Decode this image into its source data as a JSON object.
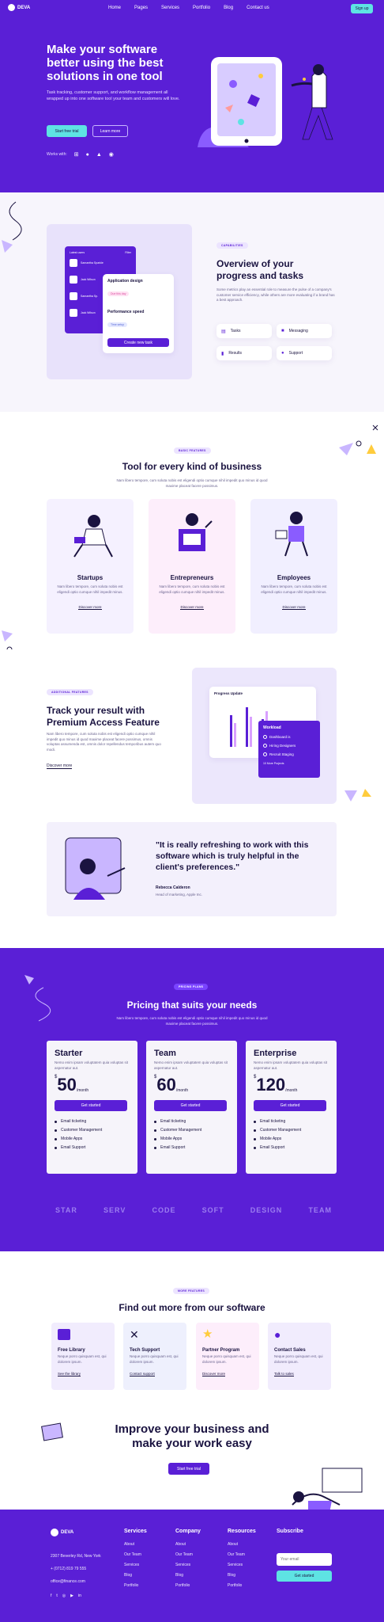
{
  "nav": {
    "brand": "DEVA",
    "links": [
      "Home",
      "Pages",
      "Services",
      "Portfolio",
      "Blog",
      "Contact us"
    ],
    "signup": "Sign up"
  },
  "hero": {
    "title": "Make your software better using the best solutions in one tool",
    "text": "Task tracking, customer support, and workflow management all wrapped up into one software tool your team and customers will love.",
    "btn_primary": "Start free trial",
    "btn_secondary": "Learn more",
    "works_with": "Works with:"
  },
  "overview": {
    "pill": "CAPABILITIES",
    "title": "Overview of your progress and tasks",
    "text": "Some metrics play an essential role to measure the pulse of a company's customer service efficiency, while others are more evaluating if a brand has a best approach.",
    "features": [
      "Tasks",
      "Messaging",
      "Results",
      "Support"
    ],
    "mock": {
      "header": "Latest users",
      "filter": "Filter",
      "users": [
        "Samantha Sparkle",
        "Jack Wilson",
        "Samantha Sp.",
        "Jack Wilson"
      ],
      "task1": "Application design",
      "task1_tag": "Due this day",
      "task2": "Performance speed",
      "task2_tag": "Time setup",
      "task_btn": "Create new task"
    }
  },
  "tools": {
    "pill": "BASIC FEATURES",
    "title": "Tool for every kind of business",
    "text": "Nam libero tempore, cum soluta nobis est eligendi optio cumque nihil impedit quo minus id quod maxime placeat facere possimus.",
    "cards": [
      {
        "title": "Startups",
        "text": "Nam libero tempore, cum soluta nobis est eligendi optio cumque nihil impedit minus.",
        "link": "Discover more"
      },
      {
        "title": "Entrepreneurs",
        "text": "Nam libero tempore, cum soluta nobis est eligendi optio cumque nihil impedit minus.",
        "link": "Discover more"
      },
      {
        "title": "Employees",
        "text": "Nam libero tempore, cum soluta nobis est eligendi optio cumque nihil impedit minus.",
        "link": "Discover more"
      }
    ]
  },
  "premium": {
    "pill": "ADDITIONAL FEATURES",
    "title": "Track your result with Premium Access Feature",
    "text": "Nam libero tempore, cum soluta nobis est eligendi optio cumque nihil impedit quo minus id quod maxime placeat facere possimus, omnis voluptas assumenda est, omnis dolor repellendus temporibus autem quo modi.",
    "link": "Discover more",
    "chart_title": "Progress Update",
    "workload_title": "Workload",
    "workload": [
      "Dashboard is",
      "Hiring Designers",
      "Recruit Staging"
    ],
    "workload_more": "10 More Projects"
  },
  "testimonial": {
    "quote": "\"It is really refreshing to work with this software which is truly helpful in the client's preferences.\"",
    "name": "Rebecca Calderon",
    "role": "Head of marketing, Apple Inc."
  },
  "pricing": {
    "pill": "PRICING PLANS",
    "title": "Pricing that suits your needs",
    "text": "Nam libero tempore, cum soluta nobis est eligendi optio cumque nihil impedit quo minus id quod maxime placeat facere possimus.",
    "plans": [
      {
        "name": "Starter",
        "desc": "Nemo enim ipsam voluptatem quia voluptas sit aspernatur aut.",
        "currency": "$",
        "price": "50",
        "period": "/month",
        "btn": "Get started",
        "features": [
          "Email ticketing",
          "Customer Management",
          "Mobile Apps",
          "Email Support"
        ]
      },
      {
        "name": "Team",
        "desc": "Nemo enim ipsam voluptatem quia voluptas sit aspernatur aut.",
        "currency": "$",
        "price": "60",
        "period": "/month",
        "btn": "Get started",
        "features": [
          "Email ticketing",
          "Customer Management",
          "Mobile Apps",
          "Email Support"
        ]
      },
      {
        "name": "Enterprise",
        "desc": "Nemo enim ipsam voluptatem quia voluptas sit aspernatur aut.",
        "currency": "$",
        "price": "120",
        "period": "/month",
        "btn": "Get started",
        "features": [
          "Email ticketing",
          "Customer Management",
          "Mobile Apps",
          "Email Support"
        ]
      }
    ],
    "logos": [
      "STAR",
      "SERV",
      "CODE",
      "SOFT",
      "DESIGN",
      "TEAM"
    ]
  },
  "more": {
    "pill": "MORE FEATURES",
    "title": "Find out more from our software",
    "cards": [
      {
        "title": "Free Library",
        "text": "Neque porro quisquam est, qui dolorem ipsum.",
        "link": "See the library"
      },
      {
        "title": "Tech Support",
        "text": "Neque porro quisquam est, qui dolorem ipsum.",
        "link": "Contact support"
      },
      {
        "title": "Partner Program",
        "text": "Neque porro quisquam est, qui dolorem ipsum.",
        "link": "Discover more"
      },
      {
        "title": "Contact Sales",
        "text": "Neque porro quisquam est, qui dolorem ipsum.",
        "link": "Talk to sales"
      }
    ]
  },
  "cta": {
    "title": "Improve your business and make your work easy",
    "btn": "Start free trial"
  },
  "footer": {
    "brand": "DEVA",
    "address": "2307 Beverley Rd, New York",
    "phone": "+ (0712) 819 79 555",
    "email": "office@finance.com",
    "cols": [
      {
        "title": "Services",
        "links": [
          "About",
          "Our Team",
          "Services",
          "Blog",
          "Portfolio"
        ]
      },
      {
        "title": "Company",
        "links": [
          "About",
          "Our Team",
          "Services",
          "Blog",
          "Portfolio"
        ]
      },
      {
        "title": "Resources",
        "links": [
          "About",
          "Our Team",
          "Services",
          "Blog",
          "Portfolio"
        ]
      }
    ],
    "subscribe_title": "Subscribe",
    "email_placeholder": "Your email",
    "subscribe_btn": "Get started"
  },
  "colors": {
    "brand": "#5a1fd6",
    "accent": "#5ee3e3",
    "dark": "#1a1340"
  }
}
